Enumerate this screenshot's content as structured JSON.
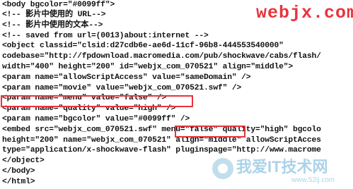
{
  "code": {
    "lines": [
      "<body bgcolor=\"#0099ff\">",
      "<!-- 影片中使用的 URL-->",
      "<!-- 影片中使用的文本-->",
      "<!-- saved from url=(0013)about:internet -->",
      "<object classid=\"clsid:d27cdb6e-ae6d-11cf-96b8-444553540000\"",
      "codebase=\"http://fpdownload.macromedia.com/pub/shockwave/cabs/flash/",
      "width=\"400\" height=\"200\" id=\"webjx_com_070521\" align=\"middle\">",
      "<param name=\"allowScriptAccess\" value=\"sameDomain\" />",
      "<param name=\"movie\" value=\"webjx_com_070521.swf\" />",
      "<param name=\"menu\" value=\"false\" />",
      "<param name=\"quality\" value=\"high\" />",
      "<param name=\"bgcolor\" value=\"#0099ff\" />",
      "<embed src=\"webjx_com_070521.swf\" menu=\"false\" quality=\"high\" bgcolo",
      "height=\"200\" name=\"webjx_com_070521\" align=\"middle\" allowScriptAcces",
      "type=\"application/x-shockwave-flash\" pluginspage=\"http://www.macrome",
      "</object>",
      "</body>",
      "</html>"
    ]
  },
  "watermarks": {
    "top_right": "webjx.com",
    "bottom_title": "我爱IT技术网",
    "bottom_url": "www.52ij.com"
  },
  "colors": {
    "highlight_border": "#e8343c",
    "watermark_top": "#e8343c",
    "watermark_bottom": "#6aaed6",
    "text": "#111111",
    "background": "#ffffff"
  }
}
